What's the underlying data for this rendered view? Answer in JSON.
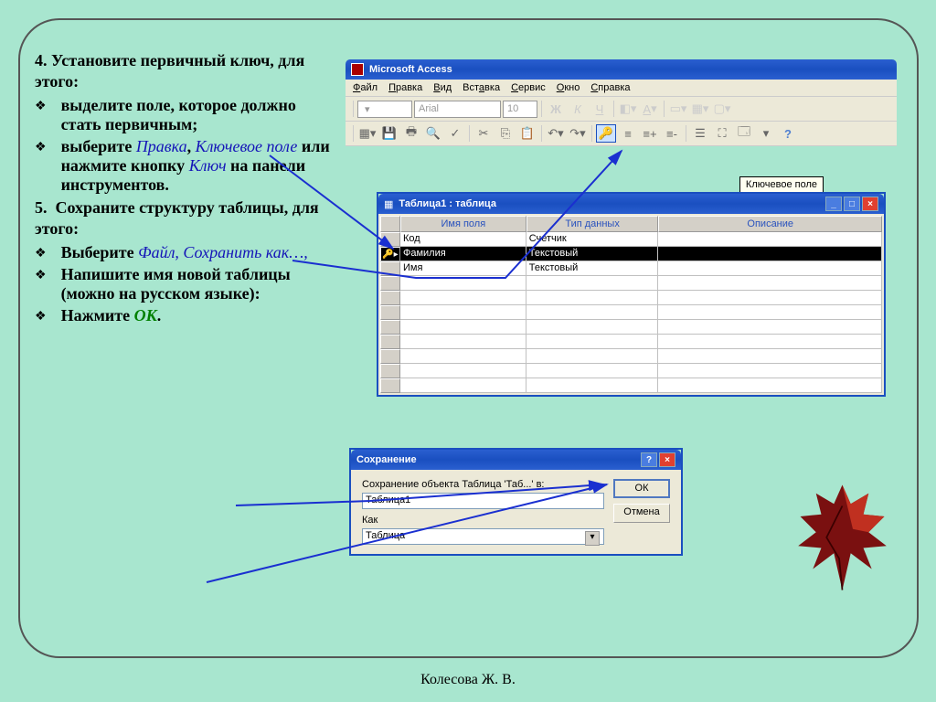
{
  "slide": {
    "step4_num": "4.",
    "step4_text": "Установите первичный ключ, для этого:",
    "b1a": "выделите  поле, которое должно стать первичным;",
    "b2_pre": "выберите ",
    "b2_pravka": "Правка",
    "b2_mid": ", ",
    "b2_keyfield": "Ключевое поле",
    "b2_post1": " или нажмите кнопку ",
    "b2_key": "Ключ",
    "b2_post2": " на панели инструментов.",
    "step5_num": "5.",
    "step5_text": "Сохраните структуру таблицы, для этого:",
    "b3_pre": "Выберите ",
    "b3_file": "Файл, Сохранить как…,",
    "b4": "Напишите  имя новой таблицы (можно на русском языке):",
    "b5_pre": "Нажмите ",
    "b5_ok": "ОК",
    "b5_post": ".",
    "footer": "Колесова Ж. В."
  },
  "app": {
    "title": "Microsoft Access",
    "menu": [
      "Файл",
      "Правка",
      "Вид",
      "Вставка",
      "Сервис",
      "Окно",
      "Справка"
    ],
    "font": "Arial",
    "fontsize": "10",
    "tooltip": "Ключевое поле"
  },
  "table_window": {
    "title": "Таблица1 : таблица",
    "headers": [
      "Имя поля",
      "Тип данных",
      "Описание"
    ],
    "rows": [
      {
        "icon": "",
        "name": "Код",
        "type": "Счетчик",
        "desc": ""
      },
      {
        "icon": "key",
        "name": "Фамилия",
        "type": "Текстовый",
        "desc": "",
        "selected": true
      },
      {
        "icon": "",
        "name": "Имя",
        "type": "Текстовый",
        "desc": ""
      }
    ]
  },
  "save_dialog": {
    "title": "Сохранение",
    "prompt": "Сохранение объекта Таблица 'Таб...' в:",
    "name_value": "Таблица1",
    "as_label": "Как",
    "as_value": "Таблица",
    "ok": "ОК",
    "cancel": "Отмена"
  }
}
